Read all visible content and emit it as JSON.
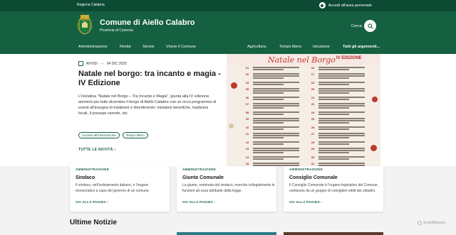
{
  "topbar": {
    "region": "Regione Calabria",
    "login": "Accedi all'area personale"
  },
  "header": {
    "title": "Comune di Aiello Calabro",
    "subtitle": "Provincia di Cosenza",
    "search_label": "Cerca"
  },
  "nav": {
    "items": [
      "Amministrazione",
      "Novità",
      "Servizi",
      "Vivere il Comune"
    ],
    "secondary": [
      "Agricoltura",
      "Tempo libero",
      "Istruzione",
      "Tutti gli argomenti..."
    ]
  },
  "featured": {
    "category": "AVVISI",
    "date": "04 DIC 2025",
    "title": "Natale nel borgo: tra incanto e magia - IV Edizione",
    "text": "L'iniziativa \"Natale nel Borgo – Tra Incanto e Magia\", giunta alla IV edizione, animerà per tutto dicembre il borgo di Aiello Calabro con un ricco programma di eventi all'insegna di tradizioni e divertimento: iniziative benefiche, tradizioni locali, il presepe vivente, etc.",
    "tags": [
      "Accessi all'informazione",
      "Tempo libero"
    ],
    "all_news": "TUTTE LE NOVITÀ"
  },
  "poster": {
    "title": "Natale nel Borgo",
    "edition": "IV EDIZIONE",
    "days_left": [
      "01",
      "02",
      "03",
      "05",
      "06",
      "07",
      "08",
      "09",
      "10",
      "11",
      "12",
      "13",
      "14",
      "15"
    ],
    "days_right": [
      "16",
      "17",
      "19",
      "20",
      "21",
      "22",
      "24",
      "25",
      "26",
      "27",
      "28",
      "29",
      "30",
      "31"
    ]
  },
  "cards": [
    {
      "category": "AMMINISTRAZIONE",
      "title": "Sindaco",
      "desc": "Il sindaco, nell'ordinamento italiano, è l'organo monocratico a capo del governo di un comune.",
      "link": "VAI ALLA PAGINA"
    },
    {
      "category": "AMMINISTRAZIONE",
      "title": "Giunta Comunale",
      "desc": "La giunta, nominata dal sindaco, esercita collegialmente le funzioni ad essa attribuite dalla legge.",
      "link": "VAI ALLA PAGINA"
    },
    {
      "category": "AMMINISTRAZIONE",
      "title": "Consiglio Comunale",
      "desc": "Il Consiglio Comunale è l'organo legislativo del Comune, composto da un gruppo di consiglieri eletti dai cittadini.",
      "link": "VAI ALLA PAGINA"
    }
  ],
  "latest_title": "Ultime Notizie",
  "watermark": "ScanMalware",
  "colors": {
    "primary": "#146041",
    "topbar": "#0c4a33",
    "poster_red": "#c0392b"
  }
}
